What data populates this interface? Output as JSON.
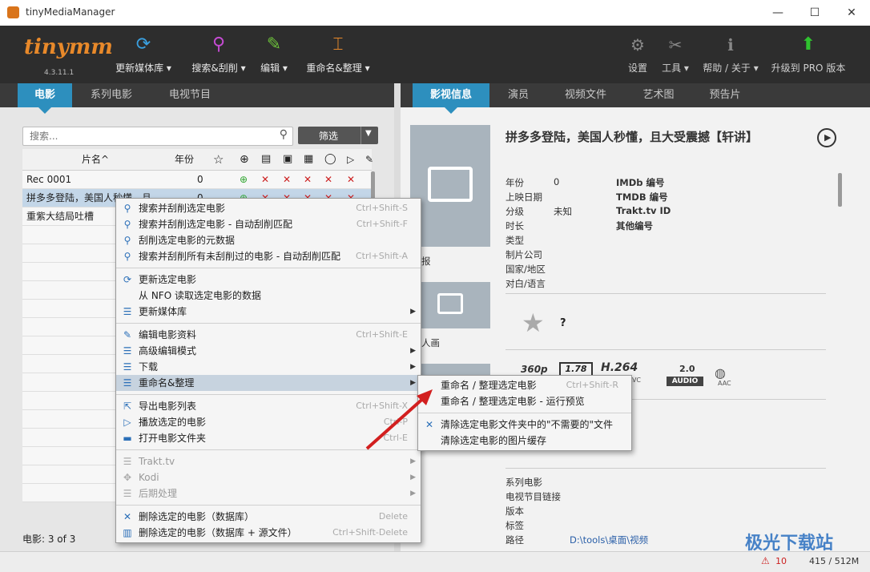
{
  "window": {
    "title": "tinyMediaManager",
    "min": "—",
    "max": "☐",
    "close": "✕"
  },
  "toolbar": {
    "logo": "tinymm",
    "version": "4.3.11.1",
    "update_library": "更新媒体库 ▾",
    "search_scrape": "搜索&刮削 ▾",
    "edit": "编辑 ▾",
    "rename": "重命名&整理 ▾",
    "settings": "设置",
    "tools": "工具 ▾",
    "help": "帮助 / 关于 ▾",
    "upgrade": "升级到 PRO 版本"
  },
  "left_tabs": [
    "电影",
    "系列电影",
    "电视节目"
  ],
  "search": {
    "placeholder": "搜索...",
    "filter_label": "筛选"
  },
  "table": {
    "col_title": "片名^",
    "col_year": "年份",
    "rows": [
      {
        "title": "Rec 0001",
        "year": "0"
      },
      {
        "title": "拼多多登陆，美国人秒懂，且",
        "year": "0"
      },
      {
        "title": "重紫大结局吐槽",
        "year": ""
      }
    ]
  },
  "footer": {
    "count_label": "电影:  3  of  3"
  },
  "context_menu": {
    "items": [
      {
        "icon": "search-icon",
        "label": "搜索并刮削选定电影",
        "shortcut": "Ctrl+Shift-S"
      },
      {
        "icon": "search-icon",
        "label": "搜索并刮削选定电影 - 自动刮削匹配",
        "shortcut": "Ctrl+Shift-F"
      },
      {
        "icon": "search-icon",
        "label": "刮削选定电影的元数据",
        "shortcut": ""
      },
      {
        "icon": "search-icon",
        "label": "搜索并刮削所有未刮削过的电影 - 自动刮削匹配",
        "shortcut": "Ctrl+Shift-A"
      },
      {
        "icon": "refresh-icon",
        "label": "更新选定电影",
        "shortcut": ""
      },
      {
        "icon": "",
        "label": "从 NFO 读取选定电影的数据",
        "shortcut": ""
      },
      {
        "icon": "list-icon",
        "label": "更新媒体库",
        "shortcut": ""
      },
      {
        "icon": "edit-icon",
        "label": "编辑电影资料",
        "shortcut": "Ctrl+Shift-E"
      },
      {
        "icon": "list-icon",
        "label": "高级编辑模式",
        "shortcut": ""
      },
      {
        "icon": "list-icon",
        "label": "下载",
        "shortcut": ""
      },
      {
        "icon": "list-icon",
        "label": "重命名&整理",
        "shortcut": ""
      },
      {
        "icon": "export-icon",
        "label": "导出电影列表",
        "shortcut": "Ctrl+Shift-X"
      },
      {
        "icon": "play-icon",
        "label": "播放选定的电影",
        "shortcut": "Ctrl-P"
      },
      {
        "icon": "folder-icon",
        "label": "打开电影文件夹",
        "shortcut": "Ctrl-E"
      },
      {
        "icon": "list-icon",
        "label": "Trakt.tv",
        "shortcut": ""
      },
      {
        "icon": "kodi-icon",
        "label": "Kodi",
        "shortcut": ""
      },
      {
        "icon": "list-icon",
        "label": "后期处理",
        "shortcut": ""
      },
      {
        "icon": "close-icon",
        "label": "删除选定的电影（数据库）",
        "shortcut": "Delete"
      },
      {
        "icon": "trash-icon",
        "label": "删除选定的电影（数据库 + 源文件）",
        "shortcut": "Ctrl+Shift-Delete"
      }
    ]
  },
  "submenu": {
    "items": [
      {
        "label": "重命名 / 整理选定电影",
        "shortcut": "Ctrl+Shift-R"
      },
      {
        "label": "重命名 / 整理选定电影 - 运行预览",
        "shortcut": ""
      },
      {
        "label": "清除选定电影文件夹中的\"不需要的\"文件",
        "shortcut": ""
      },
      {
        "label": "清除选定电影的图片缓存",
        "shortcut": ""
      }
    ]
  },
  "right_tabs": [
    "影视信息",
    "演员",
    "视频文件",
    "艺术图",
    "预告片"
  ],
  "detail": {
    "title": "拼多多登陆，美国人秒懂，且大受震撼【轩讲】",
    "poster_caption": "报",
    "fanart_caption": "人画",
    "fields_left": [
      {
        "label": "年份",
        "value": "0"
      },
      {
        "label": "上映日期",
        "value": ""
      },
      {
        "label": "分级",
        "value": "未知"
      },
      {
        "label": "时长",
        "value": ""
      },
      {
        "label": "类型",
        "value": ""
      },
      {
        "label": "制片公司",
        "value": ""
      },
      {
        "label": "国家/地区",
        "value": ""
      },
      {
        "label": "对白/语言",
        "value": ""
      }
    ],
    "fields_right": [
      "IMDb 编号",
      "TMDB 编号",
      "Trakt.tv ID",
      "其他编号"
    ],
    "rating": "?",
    "media": {
      "resolution": "360p",
      "aspect": "1.78",
      "codec": "H.264",
      "codec_sub": "AVC",
      "audio_channels": "2.0",
      "audio_label": "AUDIO",
      "audio_codec": "AAC"
    },
    "bottom_fields": [
      {
        "label": "系列电影",
        "value": ""
      },
      {
        "label": "电视节目链接",
        "value": ""
      },
      {
        "label": "版本",
        "value": ""
      },
      {
        "label": "标签",
        "value": ""
      },
      {
        "label": "路径",
        "value": "D:\\tools\\桌面\\视频"
      }
    ]
  },
  "status": {
    "warnings": "10",
    "memory": "415 / 512M"
  },
  "watermark": "极光下载站",
  "colors": {
    "accent": "#2d8fbe",
    "toolbar_bg": "#2d2d2d",
    "logo": "#e8892a",
    "error_x": "#cc1f1f",
    "add": "#2fa52f"
  }
}
